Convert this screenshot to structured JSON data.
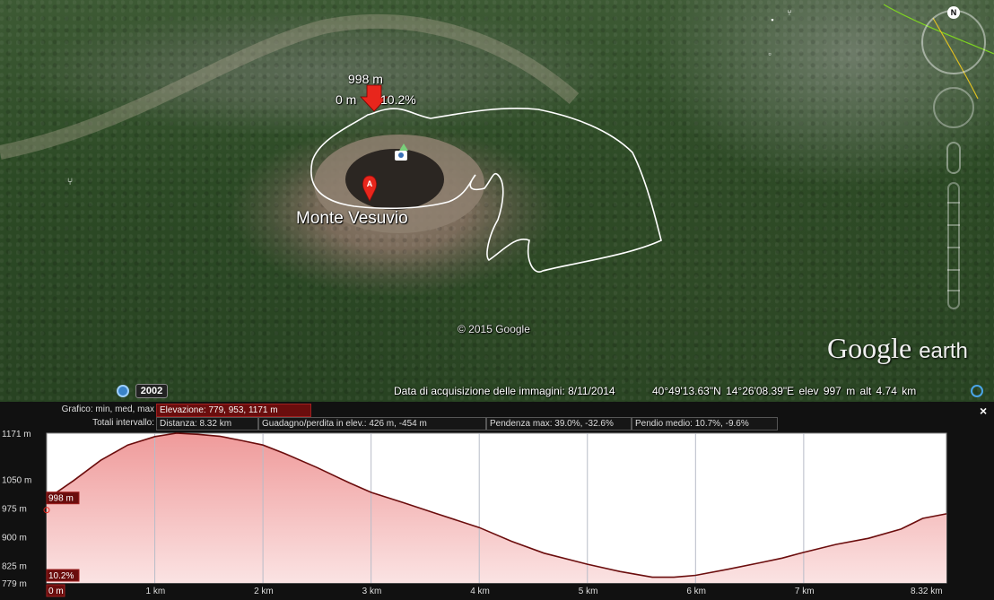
{
  "map": {
    "place_label": "Monte Vesuvio",
    "marker_letter": "A",
    "cursor": {
      "elevation": "998 m",
      "distance": "0 m",
      "slope": "10.2%"
    },
    "copyright": "© 2015 Google",
    "imagery_date": "Data di acquisizione delle immagini: 8/11/2014",
    "coordinates": "40°49'13.63\"N  14°26'08.39\"E  elev  997 m     alt  4.74 km",
    "historical_year": "2002",
    "brand": {
      "google": "Google",
      "earth": "earth"
    },
    "compass_label": "N",
    "colors": {
      "path": "#ffffff",
      "marker": "#e8261c",
      "arrow": "#e8261c"
    }
  },
  "profile": {
    "close_label": "×",
    "graph_label": "Grafico: min, med, max",
    "graph_value": "Elevazione: 779, 953, 1171 m",
    "totals_label": "Totali intervallo:",
    "distance": "Distanza: 8.32 km",
    "gain_loss": "Guadagno/perdita in elev.: 426 m, -454 m",
    "max_slope": "Pendenza max: 39.0%, -32.6%",
    "avg_slope": "Pendio medio: 10.7%, -9.6%",
    "cursor_elev_label": "998 m",
    "cursor_slope_label": "10.2%",
    "cursor_dist_label": "0 m"
  },
  "chart_data": {
    "type": "area",
    "xlabel": "",
    "ylabel": "",
    "xlim": [
      0,
      8.32
    ],
    "ylim": [
      779,
      1171
    ],
    "y_ticks": [
      {
        "value": 1171,
        "label": "1171 m"
      },
      {
        "value": 1050,
        "label": "1050 m"
      },
      {
        "value": 975,
        "label": "975 m"
      },
      {
        "value": 900,
        "label": "900 m"
      },
      {
        "value": 825,
        "label": "825 m"
      },
      {
        "value": 779,
        "label": "779 m"
      }
    ],
    "x_ticks": [
      {
        "value": 1,
        "label": "1 km"
      },
      {
        "value": 2,
        "label": "2 km"
      },
      {
        "value": 3,
        "label": "3 km"
      },
      {
        "value": 4,
        "label": "4 km"
      },
      {
        "value": 5,
        "label": "5 km"
      },
      {
        "value": 6,
        "label": "6 km"
      },
      {
        "value": 7,
        "label": "7 km"
      },
      {
        "value": 8.32,
        "label": "8.32 km"
      }
    ],
    "series": [
      {
        "x": [
          0,
          0.25,
          0.5,
          0.75,
          1.0,
          1.2,
          1.4,
          1.6,
          1.8,
          2.0,
          2.2,
          2.5,
          2.8,
          3.0,
          3.3,
          3.6,
          4.0,
          4.3,
          4.6,
          5.0,
          5.3,
          5.6,
          5.8,
          6.0,
          6.3,
          6.6,
          6.8,
          7.0,
          7.3,
          7.6,
          7.9,
          8.1,
          8.32
        ],
        "y": [
          998,
          1047,
          1100,
          1140,
          1162,
          1171,
          1168,
          1163,
          1152,
          1140,
          1118,
          1081,
          1041,
          1016,
          989,
          961,
          924,
          888,
          857,
          828,
          809,
          794,
          794,
          799,
          815,
          832,
          844,
          859,
          880,
          896,
          920,
          948,
          960
        ]
      }
    ],
    "grid": true,
    "colors": {
      "line": "#6b0d0d",
      "fill_top": "#ef9a9a",
      "fill_bottom": "#fbe3e3",
      "background": "#ffffff",
      "grid": "#b8bcc8"
    }
  }
}
